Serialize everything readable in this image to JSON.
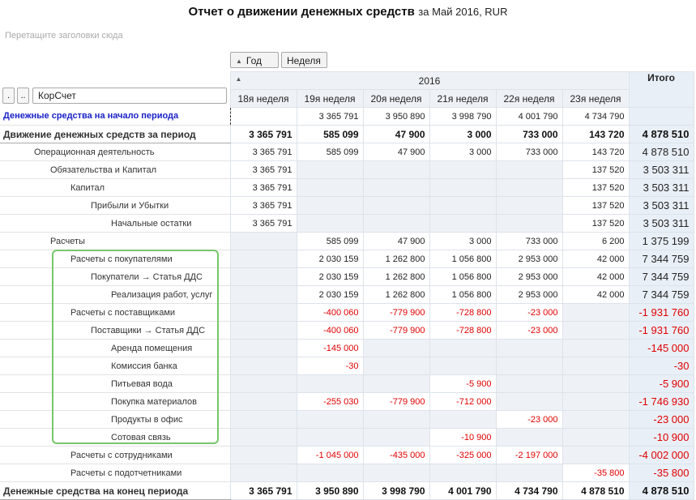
{
  "report": {
    "title": "Отчет о движении денежных средств",
    "subtitle": "за Май 2016, RUR",
    "drop_zone_text": "Перетащите заголовки сюда"
  },
  "column_dims": [
    {
      "label": "Год",
      "icon": "sort-triangle-icon"
    },
    {
      "label": "Неделя"
    }
  ],
  "row_controls": {
    "btn1": ".",
    "btn2": "..",
    "field_label": "КорСчет"
  },
  "header": {
    "year": "2016",
    "weeks": [
      "18я неделя",
      "19я неделя",
      "20я неделя",
      "21я неделя",
      "22я неделя",
      "23я неделя"
    ],
    "total": "Итого"
  },
  "rows": [
    {
      "label": "Денежные средства на начало периода",
      "level": 0,
      "style": "blue",
      "values": [
        "",
        "3 365 791",
        "3 950 890",
        "3 998 790",
        "4 001 790",
        "4 734 790"
      ],
      "total": ""
    },
    {
      "label": "Движение денежных средств за период",
      "level": 0,
      "style": "bold",
      "values": [
        "3 365 791",
        "585 099",
        "47 900",
        "3 000",
        "733 000",
        "143 720"
      ],
      "total": "4 878 510"
    },
    {
      "label": "Операционная деятельность",
      "level": 1,
      "style": "",
      "values": [
        "3 365 791",
        "585 099",
        "47 900",
        "3 000",
        "733 000",
        "143 720"
      ],
      "total": "4 878 510"
    },
    {
      "label": "Обязательства и Капитал",
      "level": 2,
      "style": "",
      "values": [
        "3 365 791",
        "",
        "",
        "",
        "",
        "137 520"
      ],
      "total": "3 503 311"
    },
    {
      "label": "Капитал",
      "level": 3,
      "style": "",
      "values": [
        "3 365 791",
        "",
        "",
        "",
        "",
        "137 520"
      ],
      "total": "3 503 311"
    },
    {
      "label": "Прибыли и Убытки",
      "level": 4,
      "style": "",
      "values": [
        "3 365 791",
        "",
        "",
        "",
        "",
        "137 520"
      ],
      "total": "3 503 311"
    },
    {
      "label": "Начальные остатки",
      "level": 5,
      "style": "",
      "values": [
        "3 365 791",
        "",
        "",
        "",
        "",
        "137 520"
      ],
      "total": "3 503 311"
    },
    {
      "label": "Расчеты",
      "level": 2,
      "style": "",
      "values": [
        "",
        "585 099",
        "47 900",
        "3 000",
        "733 000",
        "6 200"
      ],
      "total": "1 375 199"
    },
    {
      "label": "Расчеты с покупателями",
      "level": 3,
      "style": "",
      "values": [
        "",
        "2 030 159",
        "1 262 800",
        "1 056 800",
        "2 953 000",
        "42 000"
      ],
      "total": "7 344 759"
    },
    {
      "label": "Покупатели → Статья ДДС",
      "level": 4,
      "style": "",
      "values": [
        "",
        "2 030 159",
        "1 262 800",
        "1 056 800",
        "2 953 000",
        "42 000"
      ],
      "total": "7 344 759"
    },
    {
      "label": "Реализация работ, услуг",
      "level": 5,
      "style": "",
      "values": [
        "",
        "2 030 159",
        "1 262 800",
        "1 056 800",
        "2 953 000",
        "42 000"
      ],
      "total": "7 344 759"
    },
    {
      "label": "Расчеты с поставщиками",
      "level": 3,
      "style": "",
      "values": [
        "",
        "-400 060",
        "-779 900",
        "-728 800",
        "-23 000",
        ""
      ],
      "total": "-1 931 760"
    },
    {
      "label": "Поставщики → Статья ДДС",
      "level": 4,
      "style": "",
      "values": [
        "",
        "-400 060",
        "-779 900",
        "-728 800",
        "-23 000",
        ""
      ],
      "total": "-1 931 760"
    },
    {
      "label": "Аренда помещения",
      "level": 5,
      "style": "",
      "values": [
        "",
        "-145 000",
        "",
        "",
        "",
        ""
      ],
      "total": "-145 000"
    },
    {
      "label": "Комиссия банка",
      "level": 5,
      "style": "",
      "values": [
        "",
        "-30",
        "",
        "",
        "",
        ""
      ],
      "total": "-30"
    },
    {
      "label": "Питьевая вода",
      "level": 5,
      "style": "",
      "values": [
        "",
        "",
        "",
        "-5 900",
        "",
        ""
      ],
      "total": "-5 900"
    },
    {
      "label": "Покупка материалов",
      "level": 5,
      "style": "",
      "values": [
        "",
        "-255 030",
        "-779 900",
        "-712 000",
        "",
        ""
      ],
      "total": "-1 746 930"
    },
    {
      "label": "Продукты в офис",
      "level": 5,
      "style": "",
      "values": [
        "",
        "",
        "",
        "",
        "-23 000",
        ""
      ],
      "total": "-23 000"
    },
    {
      "label": "Сотовая связь",
      "level": 5,
      "style": "",
      "values": [
        "",
        "",
        "",
        "-10 900",
        "",
        ""
      ],
      "total": "-10 900"
    },
    {
      "label": "Расчеты с сотрудниками",
      "level": 3,
      "style": "",
      "values": [
        "",
        "-1 045 000",
        "-435 000",
        "-325 000",
        "-2 197 000",
        ""
      ],
      "total": "-4 002 000"
    },
    {
      "label": "Расчеты с подотчетниками",
      "level": 3,
      "style": "",
      "values": [
        "",
        "",
        "",
        "",
        "",
        "-35 800"
      ],
      "total": "-35 800"
    },
    {
      "label": "Денежные средства на конец периода",
      "level": 0,
      "style": "bold-end",
      "values": [
        "3 365 791",
        "3 950 890",
        "3 998 790",
        "4 001 790",
        "4 734 790",
        "4 878 510"
      ],
      "total": "4 878 510"
    }
  ],
  "colors": {
    "negative": "#e00000",
    "link_blue": "#1a22c8",
    "highlight_green": "#76c76a",
    "header_bg": "#eef2f7"
  }
}
